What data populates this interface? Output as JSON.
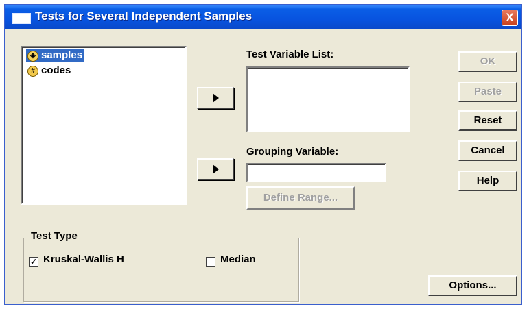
{
  "window": {
    "title": "Tests for Several Independent Samples",
    "close_glyph": "X"
  },
  "variables": [
    {
      "name": "samples",
      "icon": "scale-variable-icon",
      "selected": true
    },
    {
      "name": "codes",
      "icon": "nominal-variable-icon",
      "selected": false
    }
  ],
  "test_variable_list": {
    "label": "Test Variable List:"
  },
  "grouping_variable": {
    "label": "Grouping Variable:",
    "value": ""
  },
  "define_range_label": "Define Range...",
  "buttons": {
    "ok": "OK",
    "paste": "Paste",
    "reset": "Reset",
    "cancel": "Cancel",
    "help": "Help",
    "options": "Options..."
  },
  "test_type": {
    "title": "Test Type",
    "kruskal": {
      "label": "Kruskal-Wallis H",
      "checked": true
    },
    "median": {
      "label": "Median",
      "checked": false
    }
  }
}
